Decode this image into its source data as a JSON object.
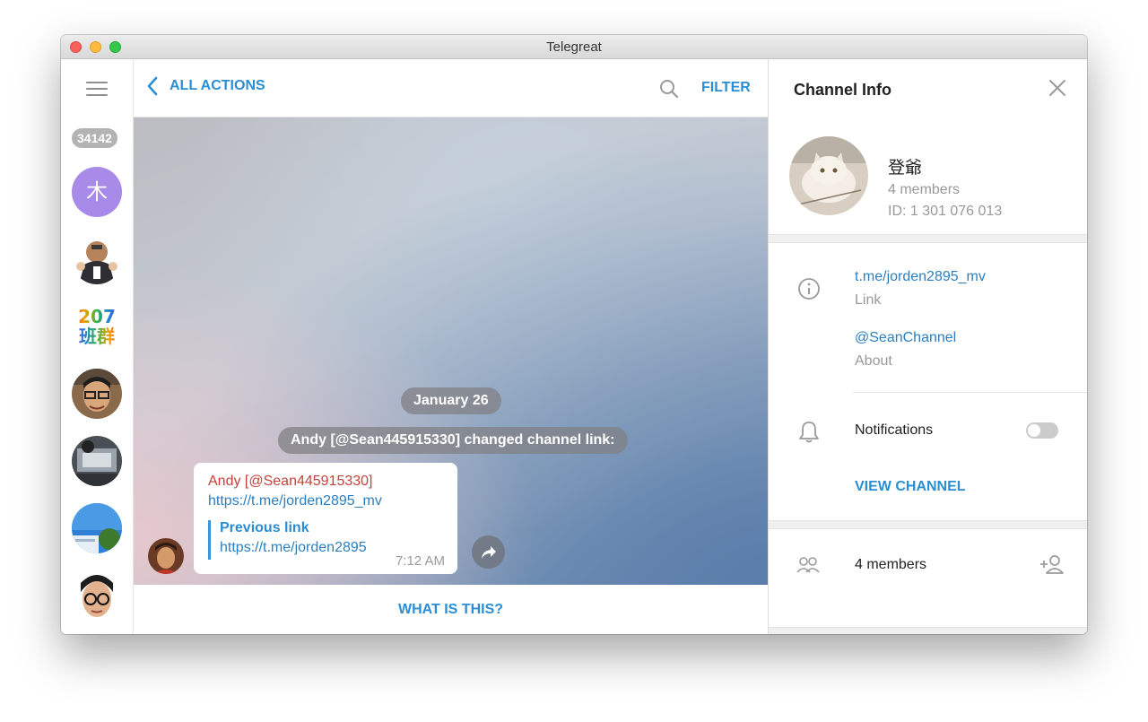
{
  "window": {
    "title": "Telegreat"
  },
  "sidebar": {
    "unread_count": "34142",
    "first_avatar_letter": "木",
    "text_avatar": {
      "line1": "207",
      "line2": "班群"
    }
  },
  "chat": {
    "header": {
      "back_label": "ALL ACTIONS",
      "filter_label": "FILTER"
    },
    "date_label": "January 26",
    "service_message": "Andy [@Sean445915330] changed channel link:",
    "message": {
      "sender": "Andy [@Sean445915330]",
      "new_link": "https://t.me/jorden2895_mv",
      "quote_title": "Previous link",
      "old_link": "https://t.me/jorden2895",
      "time": "7:12 AM"
    },
    "footer_label": "WHAT IS THIS?"
  },
  "info": {
    "title": "Channel Info",
    "channel_name": "登爺",
    "members_count": "4 members",
    "channel_id": "ID: 1 301 076 013",
    "link": "t.me/jorden2895_mv",
    "link_caption": "Link",
    "about": "@SeanChannel",
    "about_caption": "About",
    "notifications_label": "Notifications",
    "notifications_on": false,
    "view_channel_label": "VIEW CHANNEL",
    "members_label": "4 members"
  },
  "colors": {
    "accent": "#2b8ed3",
    "sender": "#c6423a",
    "muted": "#999999"
  }
}
